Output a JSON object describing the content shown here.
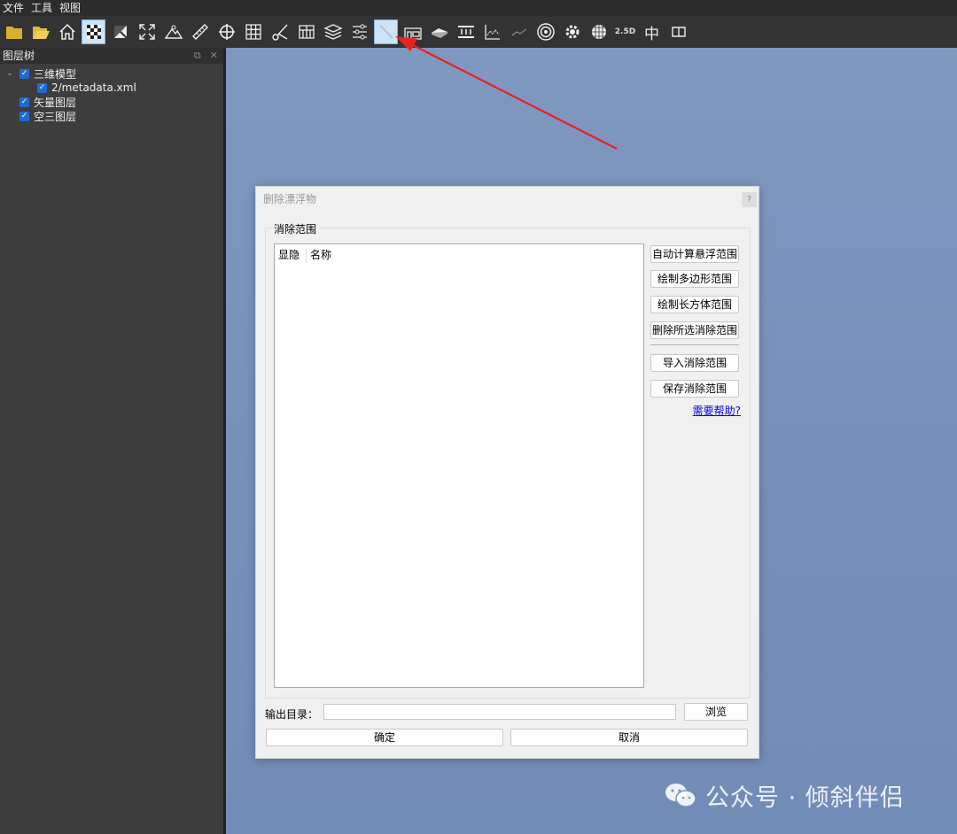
{
  "menubar": {
    "items": [
      "文件",
      "工具",
      "视图"
    ]
  },
  "toolbar": {
    "text_25d": "2.5D",
    "text_zhong": "中"
  },
  "layer_panel": {
    "title": "图层树",
    "tree": [
      {
        "label": "三维模型",
        "checked": true,
        "expanded": true
      },
      {
        "label": "2/metadata.xml",
        "checked": true
      },
      {
        "label": "矢量图层",
        "checked": true
      },
      {
        "label": "空三图层",
        "checked": true
      }
    ]
  },
  "dialog": {
    "title": "删除漂浮物",
    "help_button": "?",
    "group_title": "消除范围",
    "table_headers": [
      "显隐",
      "名称"
    ],
    "buttons": {
      "auto_calc": "自动计算悬浮范围",
      "draw_polygon": "绘制多边形范围",
      "draw_cuboid": "绘制长方体范围",
      "delete_selected": "删除所选消除范围",
      "import": "导入消除范围",
      "save": "保存消除范围",
      "browse": "浏览",
      "ok": "确定",
      "cancel": "取消"
    },
    "help_link": "需要帮助?",
    "output_label": "输出目录：",
    "output_value": ""
  },
  "watermark": {
    "text": "公众号 · 倾斜伴侣"
  },
  "colors": {
    "viewport": "#7891bb",
    "panel": "#3d3d3d",
    "arrow": "#e8231e",
    "checkbox": "#1e6bd6"
  }
}
